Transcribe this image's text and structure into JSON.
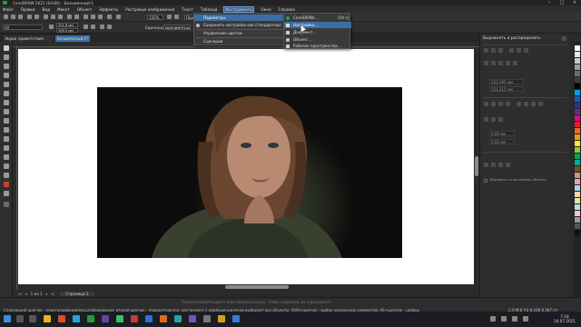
{
  "title": "CorelDRAW 2021 (64-Bit) - Безымянный-1",
  "menu": [
    "Файл",
    "Правка",
    "Вид",
    "Макет",
    "Объект",
    "Эффекты",
    "Растровые изображения",
    "Текст",
    "Таблица",
    "Инструменты",
    "Окно",
    "Справка"
  ],
  "active_menu": "Инструменты",
  "toolbar": {
    "zoom": "150%",
    "snap": "Привязать к",
    "font": "All"
  },
  "propbar": {
    "x": "201,8 мм",
    "y": "199,5 мм",
    "units_label": "Единицы:",
    "units": "миллиметры"
  },
  "tabs": [
    "Экран приветствия",
    "Безымянный-1*"
  ],
  "tools_menu": {
    "items": [
      {
        "label": "Параметры",
        "arrow": "›"
      },
      {
        "label": "Сохранить настройки как стандартные",
        "arrow": ""
      },
      {
        "label": "Управление цветом",
        "arrow": "›"
      },
      {
        "label": "Сценарии",
        "arrow": "›"
      }
    ]
  },
  "options_submenu": {
    "items": [
      {
        "label": "CorelDRAW...",
        "shortcut": "Ctrl+J"
      },
      {
        "label": "Настройка...",
        "shortcut": ""
      },
      {
        "label": "Документ...",
        "shortcut": ""
      },
      {
        "label": "Объект...",
        "shortcut": ""
      },
      {
        "label": "Рабочие пространства...",
        "shortcut": ""
      }
    ]
  },
  "docker": {
    "title": "Выровнять и распределить",
    "field1": "203,195 мм",
    "field2": "151,315 мм",
    "val1": "0,00 мм",
    "val2": "0,00 мм",
    "checkbox_label": "Выровнять к активному объекту"
  },
  "pagenav": {
    "pages": "1 из 1",
    "page_tab": "Страница 1"
  },
  "status": {
    "hint": "Перетаскивайте цвета (или объекты) сюда, чтобы сохранить их в документе",
    "text": "Следующий щелчок - перетаскивание/масштабирование; второй щелчок - поворот/наклон; инструмент с двойным щелчком выбирает все объекты; Shift+щелчок - выбор нескольких элементов; Alt+щелчок - цифры",
    "coords": "C:0 M:0 Y:0 K:100  0,567 пт"
  },
  "clock": {
    "time": "7:18",
    "date": "14.07.2021"
  },
  "colors": {
    "accent": "#3b6ea5",
    "menu_bg": "#3a3a3a",
    "workspace": "#2b2b2b"
  },
  "palette": [
    "#ffffff",
    "#e6e6e6",
    "#c8c8c8",
    "#9e9e9e",
    "#6c6c6c",
    "#3c3c3c",
    "#000000",
    "#00a0e6",
    "#0066b3",
    "#2e3192",
    "#662d91",
    "#ec008c",
    "#ed1c24",
    "#f26522",
    "#f7941d",
    "#fff200",
    "#8dc63f",
    "#00a651",
    "#00a99d",
    "#754c24",
    "#c69c6d",
    "#f49ac1",
    "#a3d7f0",
    "#fcd6a5",
    "#d9ec9f",
    "#b3e2d9",
    "#e8c5e0",
    "#999999",
    "#555555",
    "#111111"
  ]
}
